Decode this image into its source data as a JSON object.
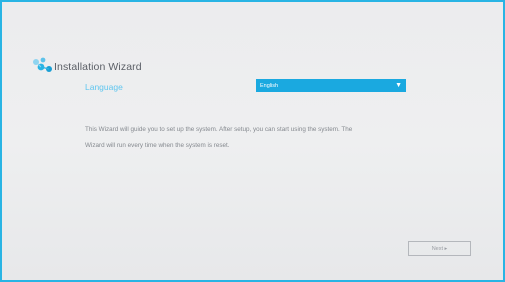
{
  "wizard": {
    "title": "Installation Wizard",
    "language_label": "Language",
    "language_selected": "English",
    "description_line1": "This Wizard will guide you to set up the system. After setup, you can start using the system. The",
    "description_line2": "Wizard will run every time when the system is reset.",
    "next_label": "Next ▸"
  },
  "icons": {
    "logo": "brand-logo-icon",
    "dropdown": "triangle-down-icon"
  },
  "colors": {
    "accent": "#1aa9e0",
    "border": "#29b4e4",
    "label": "#5fc6ef",
    "background": "#ececee"
  }
}
